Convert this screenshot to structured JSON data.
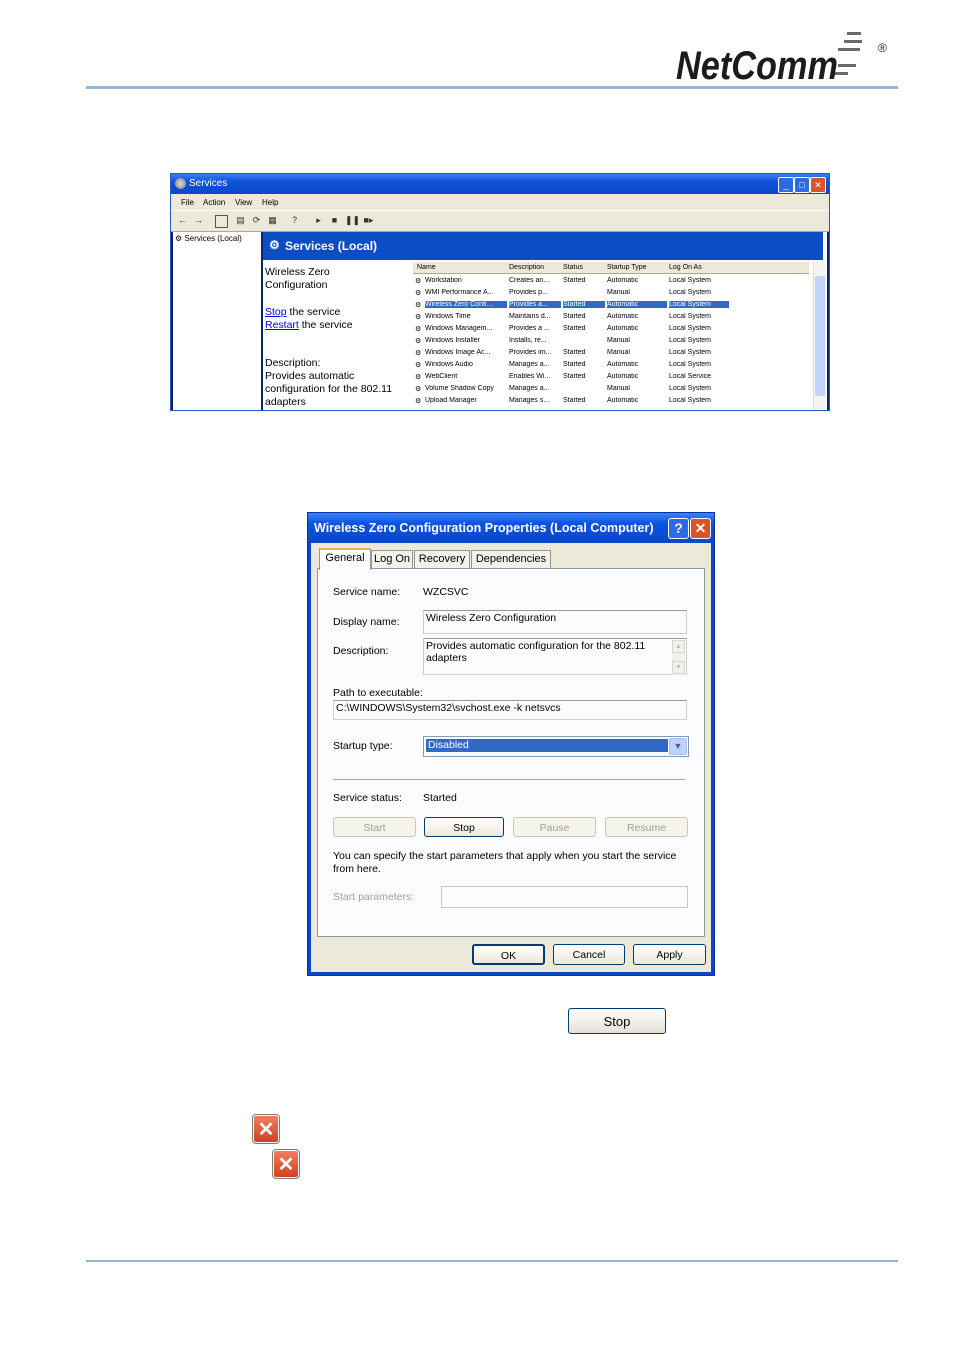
{
  "logo": {
    "text": "NetComm",
    "mark": "®"
  },
  "services_window": {
    "title": "Services",
    "menu": [
      "File",
      "Action",
      "View",
      "Help"
    ],
    "tree_node": "Services (Local)",
    "banner": "Services (Local)",
    "selected_service": "Wireless Zero Configuration",
    "stop_link": "Stop",
    "stop_suffix": " the service",
    "restart_link": "Restart",
    "restart_suffix": " the service",
    "description_label": "Description:",
    "description_text": "Provides automatic configuration for the 802.11 adapters",
    "columns": [
      "Name",
      "Description",
      "Status",
      "Startup Type",
      "Log On As"
    ],
    "rows": [
      [
        "Workstation",
        "Creates an...",
        "Started",
        "Automatic",
        "Local System"
      ],
      [
        "WMI Performance A...",
        "Provides p...",
        "",
        "Manual",
        "Local System"
      ],
      [
        "Wireless Zero Confi...",
        "Provides a...",
        "Started",
        "Automatic",
        "Local System"
      ],
      [
        "Windows Time",
        "Maintains d...",
        "Started",
        "Automatic",
        "Local System"
      ],
      [
        "Windows Managem...",
        "Provides a ...",
        "Started",
        "Automatic",
        "Local System"
      ],
      [
        "Windows Installer",
        "Installs, re...",
        "",
        "Manual",
        "Local System"
      ],
      [
        "Windows Image Ac...",
        "Provides im...",
        "Started",
        "Manual",
        "Local System"
      ],
      [
        "Windows Audio",
        "Manages a...",
        "Started",
        "Automatic",
        "Local System"
      ],
      [
        "WebClient",
        "Enables Wi...",
        "Started",
        "Automatic",
        "Local Service"
      ],
      [
        "Volume Shadow Copy",
        "Manages a...",
        "",
        "Manual",
        "Local System"
      ],
      [
        "Upload Manager",
        "Manages s...",
        "Started",
        "Automatic",
        "Local System"
      ]
    ],
    "selected_row": 2
  },
  "properties_dialog": {
    "title": "Wireless Zero Configuration Properties (Local Computer)",
    "tabs": [
      "General",
      "Log On",
      "Recovery",
      "Dependencies"
    ],
    "service_name_label": "Service name:",
    "service_name": "WZCSVC",
    "display_name_label": "Display name:",
    "display_name": "Wireless Zero Configuration",
    "description_label": "Description:",
    "description": "Provides automatic configuration for the 802.11 adapters",
    "path_label": "Path to executable:",
    "path": "C:\\WINDOWS\\System32\\svchost.exe -k netsvcs",
    "startup_type_label": "Startup type:",
    "startup_type": "Disabled",
    "service_status_label": "Service status:",
    "service_status": "Started",
    "buttons": {
      "start": "Start",
      "stop": "Stop",
      "pause": "Pause",
      "resume": "Resume"
    },
    "hint": "You can specify the start parameters that apply when you start the service from here.",
    "start_params_label": "Start parameters:",
    "start_params": "",
    "footer": {
      "ok": "OK",
      "cancel": "Cancel",
      "apply": "Apply"
    }
  },
  "standalone": {
    "stop_button": "Stop"
  },
  "colors": {
    "xp_blue": "#0a48c9",
    "selection": "#316ac5",
    "close_red": "#d9542c",
    "rule": "#9bb5d5"
  }
}
